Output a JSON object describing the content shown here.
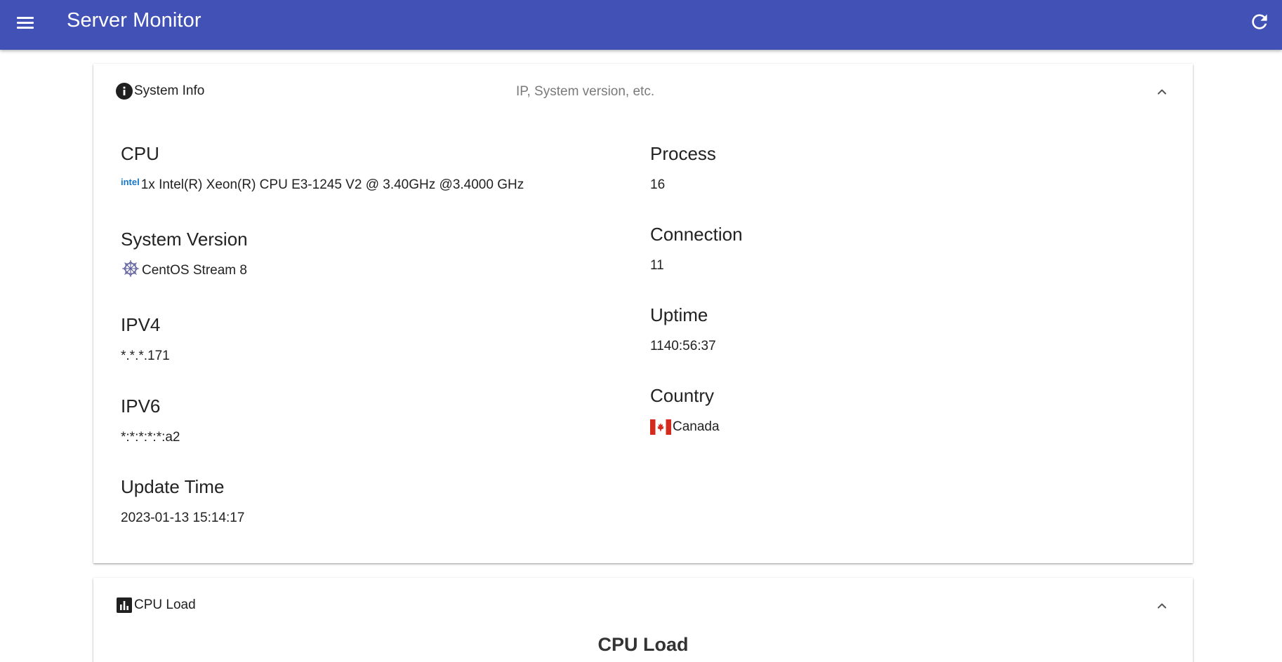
{
  "app": {
    "title": "Server Monitor"
  },
  "colors": {
    "appbar": "#4151b6",
    "flag_red": "#d52b1e",
    "intel_blue": "#1877c9"
  },
  "icons": {
    "menu": "menu-icon",
    "refresh": "refresh-icon",
    "info": "info-icon",
    "bar_chart": "bar-chart-icon",
    "chevron": "chevron-up-icon",
    "cpu_vendor": "intel-logo-icon",
    "os": "centos-logo-icon",
    "country_flag": "canada-flag-icon"
  },
  "system_info": {
    "title": "System Info",
    "subtitle": "IP, System version, etc.",
    "cpu": {
      "label": "CPU",
      "vendor_logo_text": "intel",
      "value": "1x Intel(R) Xeon(R) CPU E3-1245 V2 @ 3.40GHz @3.4000 GHz"
    },
    "system_version": {
      "label": "System Version",
      "value": "CentOS Stream 8"
    },
    "ipv4": {
      "label": "IPV4",
      "value": "*.*.*.171"
    },
    "ipv6": {
      "label": "IPV6",
      "value": "*:*:*:*:*:a2"
    },
    "update_time": {
      "label": "Update Time",
      "value": "2023-01-13 15:14:17"
    },
    "process": {
      "label": "Process",
      "value": "16"
    },
    "connection": {
      "label": "Connection",
      "value": "11"
    },
    "uptime": {
      "label": "Uptime",
      "value": "1140:56:37"
    },
    "country": {
      "label": "Country",
      "value": "Canada"
    }
  },
  "cpu_load": {
    "title": "CPU Load",
    "chart_title": "CPU Load"
  }
}
